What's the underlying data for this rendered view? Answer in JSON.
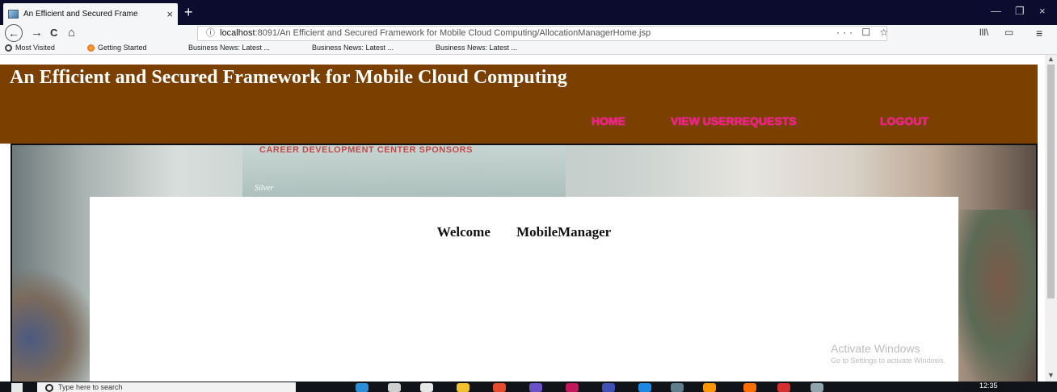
{
  "browser": {
    "tab_title": "An Efficient and Secured Frame",
    "tab_close": "×",
    "new_tab": "+",
    "window_controls": {
      "minimize": "—",
      "restore": "❐",
      "close": "×"
    },
    "url_info_icon": "ⓘ",
    "url_host": "localhost",
    "url_rest": ":8091/An Efficient and Secured Framework for Mobile Cloud Computing/AllocationManagerHome.jsp",
    "url_actions": "··· ☐ ☆",
    "toolbar_right": {
      "library": "lll\\",
      "sidebar": "▭",
      "menu": "≡"
    },
    "nav": {
      "back": "←",
      "forward": "→",
      "reload": "C",
      "home": "⌂"
    },
    "bookmarks": [
      {
        "label": "Most Visited",
        "icon": "gear-icon"
      },
      {
        "label": "Getting Started",
        "icon": "firefox-icon"
      },
      {
        "label": "Business News: Latest ..."
      },
      {
        "label": "Business News: Latest ..."
      },
      {
        "label": "Business News: Latest ..."
      }
    ]
  },
  "page": {
    "title": "An Efficient and Secured Framework for Mobile Cloud Computing",
    "nav": [
      "HOME",
      "VIEW USERREQUESTS",
      "LOGOUT"
    ],
    "banner_sign": "CAREER DEVELOPMENT CENTER SPONSORS",
    "banner_sub": "Silver",
    "welcome_label": "Welcome",
    "welcome_user": "MobileManager",
    "colors": {
      "header_bg": "#7b3f00",
      "nav_link": "#ff1493",
      "title": "#ffffff"
    }
  },
  "watermark": {
    "line1": "Activate Windows",
    "line2": "Go to Settings to activate Windows."
  },
  "taskbar": {
    "search_placeholder": "Type here to search",
    "clock": "12:35"
  }
}
